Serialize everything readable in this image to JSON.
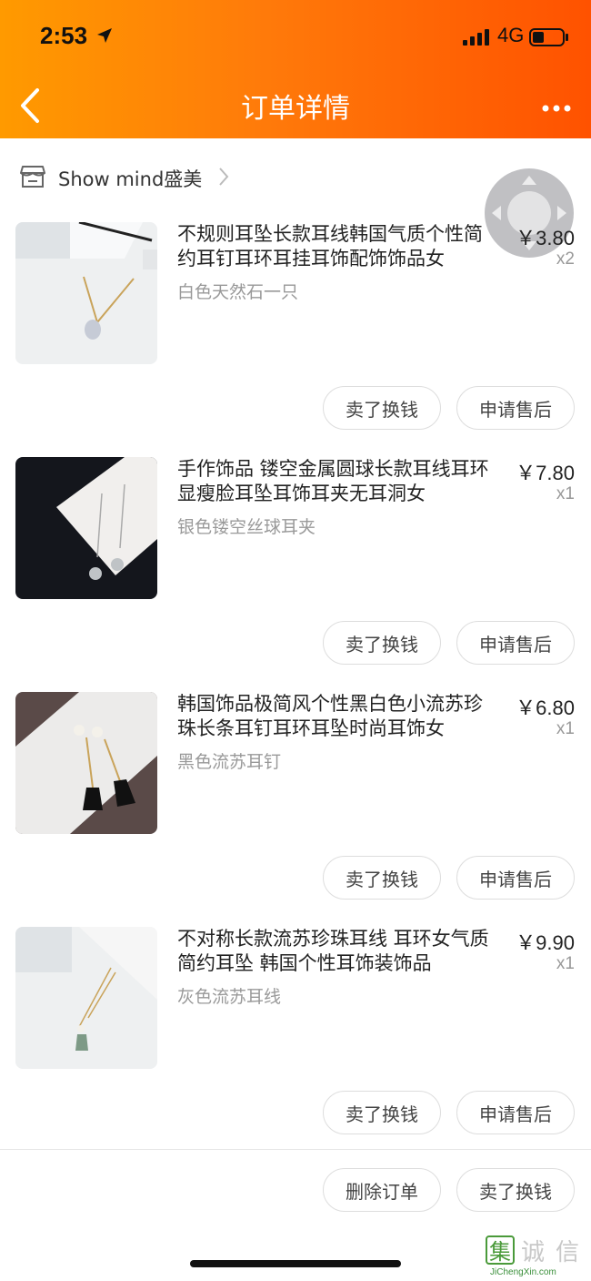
{
  "status_bar": {
    "time": "2:53",
    "network": "4G"
  },
  "nav": {
    "title": "订单详情"
  },
  "shop": {
    "name": "Show mind盛美"
  },
  "items": [
    {
      "title": "不规则耳坠长款耳线韩国气质个性简约耳钉耳环耳挂耳饰配饰饰品女",
      "spec": "白色天然石一只",
      "price": "￥3.80",
      "qty": "x2",
      "btn_sell": "卖了换钱",
      "btn_after": "申请售后"
    },
    {
      "title": "手作饰品 镂空金属圆球长款耳线耳环 显瘦脸耳坠耳饰耳夹无耳洞女",
      "spec": "银色镂空丝球耳夹",
      "price": "￥7.80",
      "qty": "x1",
      "btn_sell": "卖了换钱",
      "btn_after": "申请售后"
    },
    {
      "title": "韩国饰品极简风个性黑白色小流苏珍珠长条耳钉耳环耳坠时尚耳饰女",
      "spec": "黑色流苏耳钉",
      "price": "￥6.80",
      "qty": "x1",
      "btn_sell": "卖了换钱",
      "btn_after": "申请售后"
    },
    {
      "title": "不对称长款流苏珍珠耳线 耳环女气质简约耳坠 韩国个性耳饰装饰品",
      "spec": "灰色流苏耳线",
      "price": "￥9.90",
      "qty": "x1",
      "btn_sell": "卖了换钱",
      "btn_after": "申请售后"
    }
  ],
  "footer": {
    "delete_label": "删除订单",
    "sell_label": "卖了换钱"
  },
  "watermark": {
    "chars": "集诚信",
    "url": "JiChengXin.com"
  },
  "colors": {
    "header_start": "#ff9a00",
    "header_end": "#ff5200",
    "spec_gray": "#999999"
  }
}
